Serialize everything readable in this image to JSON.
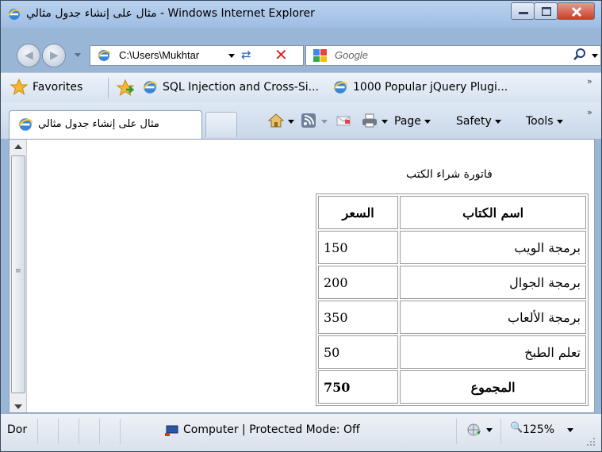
{
  "window": {
    "title": "مثال على إنشاء جدول مثالي - Windows Internet Explorer"
  },
  "address": {
    "url": "C:\\Users\\Mukhtar",
    "search_placeholder": "Google"
  },
  "favorites": {
    "label": "Favorites",
    "items": [
      "SQL Injection and Cross-Si...",
      "1000 Popular jQuery Plugi..."
    ]
  },
  "tabs": {
    "active_label": "مثال على إنشاء جدول مثالي"
  },
  "commands": {
    "page": "Page",
    "safety": "Safety",
    "tools": "Tools"
  },
  "page": {
    "caption": "فاتورة شراء الكتب",
    "table": {
      "headers": [
        "اسم الكتاب",
        "السعر"
      ],
      "rows": [
        [
          "برمجة الويب",
          "150"
        ],
        [
          "برمجة الجوال",
          "200"
        ],
        [
          "برمجة الألعاب",
          "350"
        ],
        [
          "تعلم الطبخ",
          "50"
        ]
      ],
      "total_label": "المجموع",
      "total_value": "750"
    }
  },
  "status": {
    "done": "Dor",
    "zone": "Computer | Protected Mode: Off",
    "zoom": "125%"
  },
  "colors": {
    "title_bar": "#9fbde3",
    "close_button": "#c8402b",
    "content_bg": "#ffffff"
  },
  "icons": [
    "ie-icon",
    "back-icon",
    "forward-icon",
    "refresh-icon",
    "stop-icon",
    "google-icon",
    "search-icon",
    "star-icon",
    "add-favorite-icon",
    "home-icon",
    "feed-icon",
    "mail-icon",
    "print-icon",
    "globe-icon",
    "zoom-icon"
  ]
}
